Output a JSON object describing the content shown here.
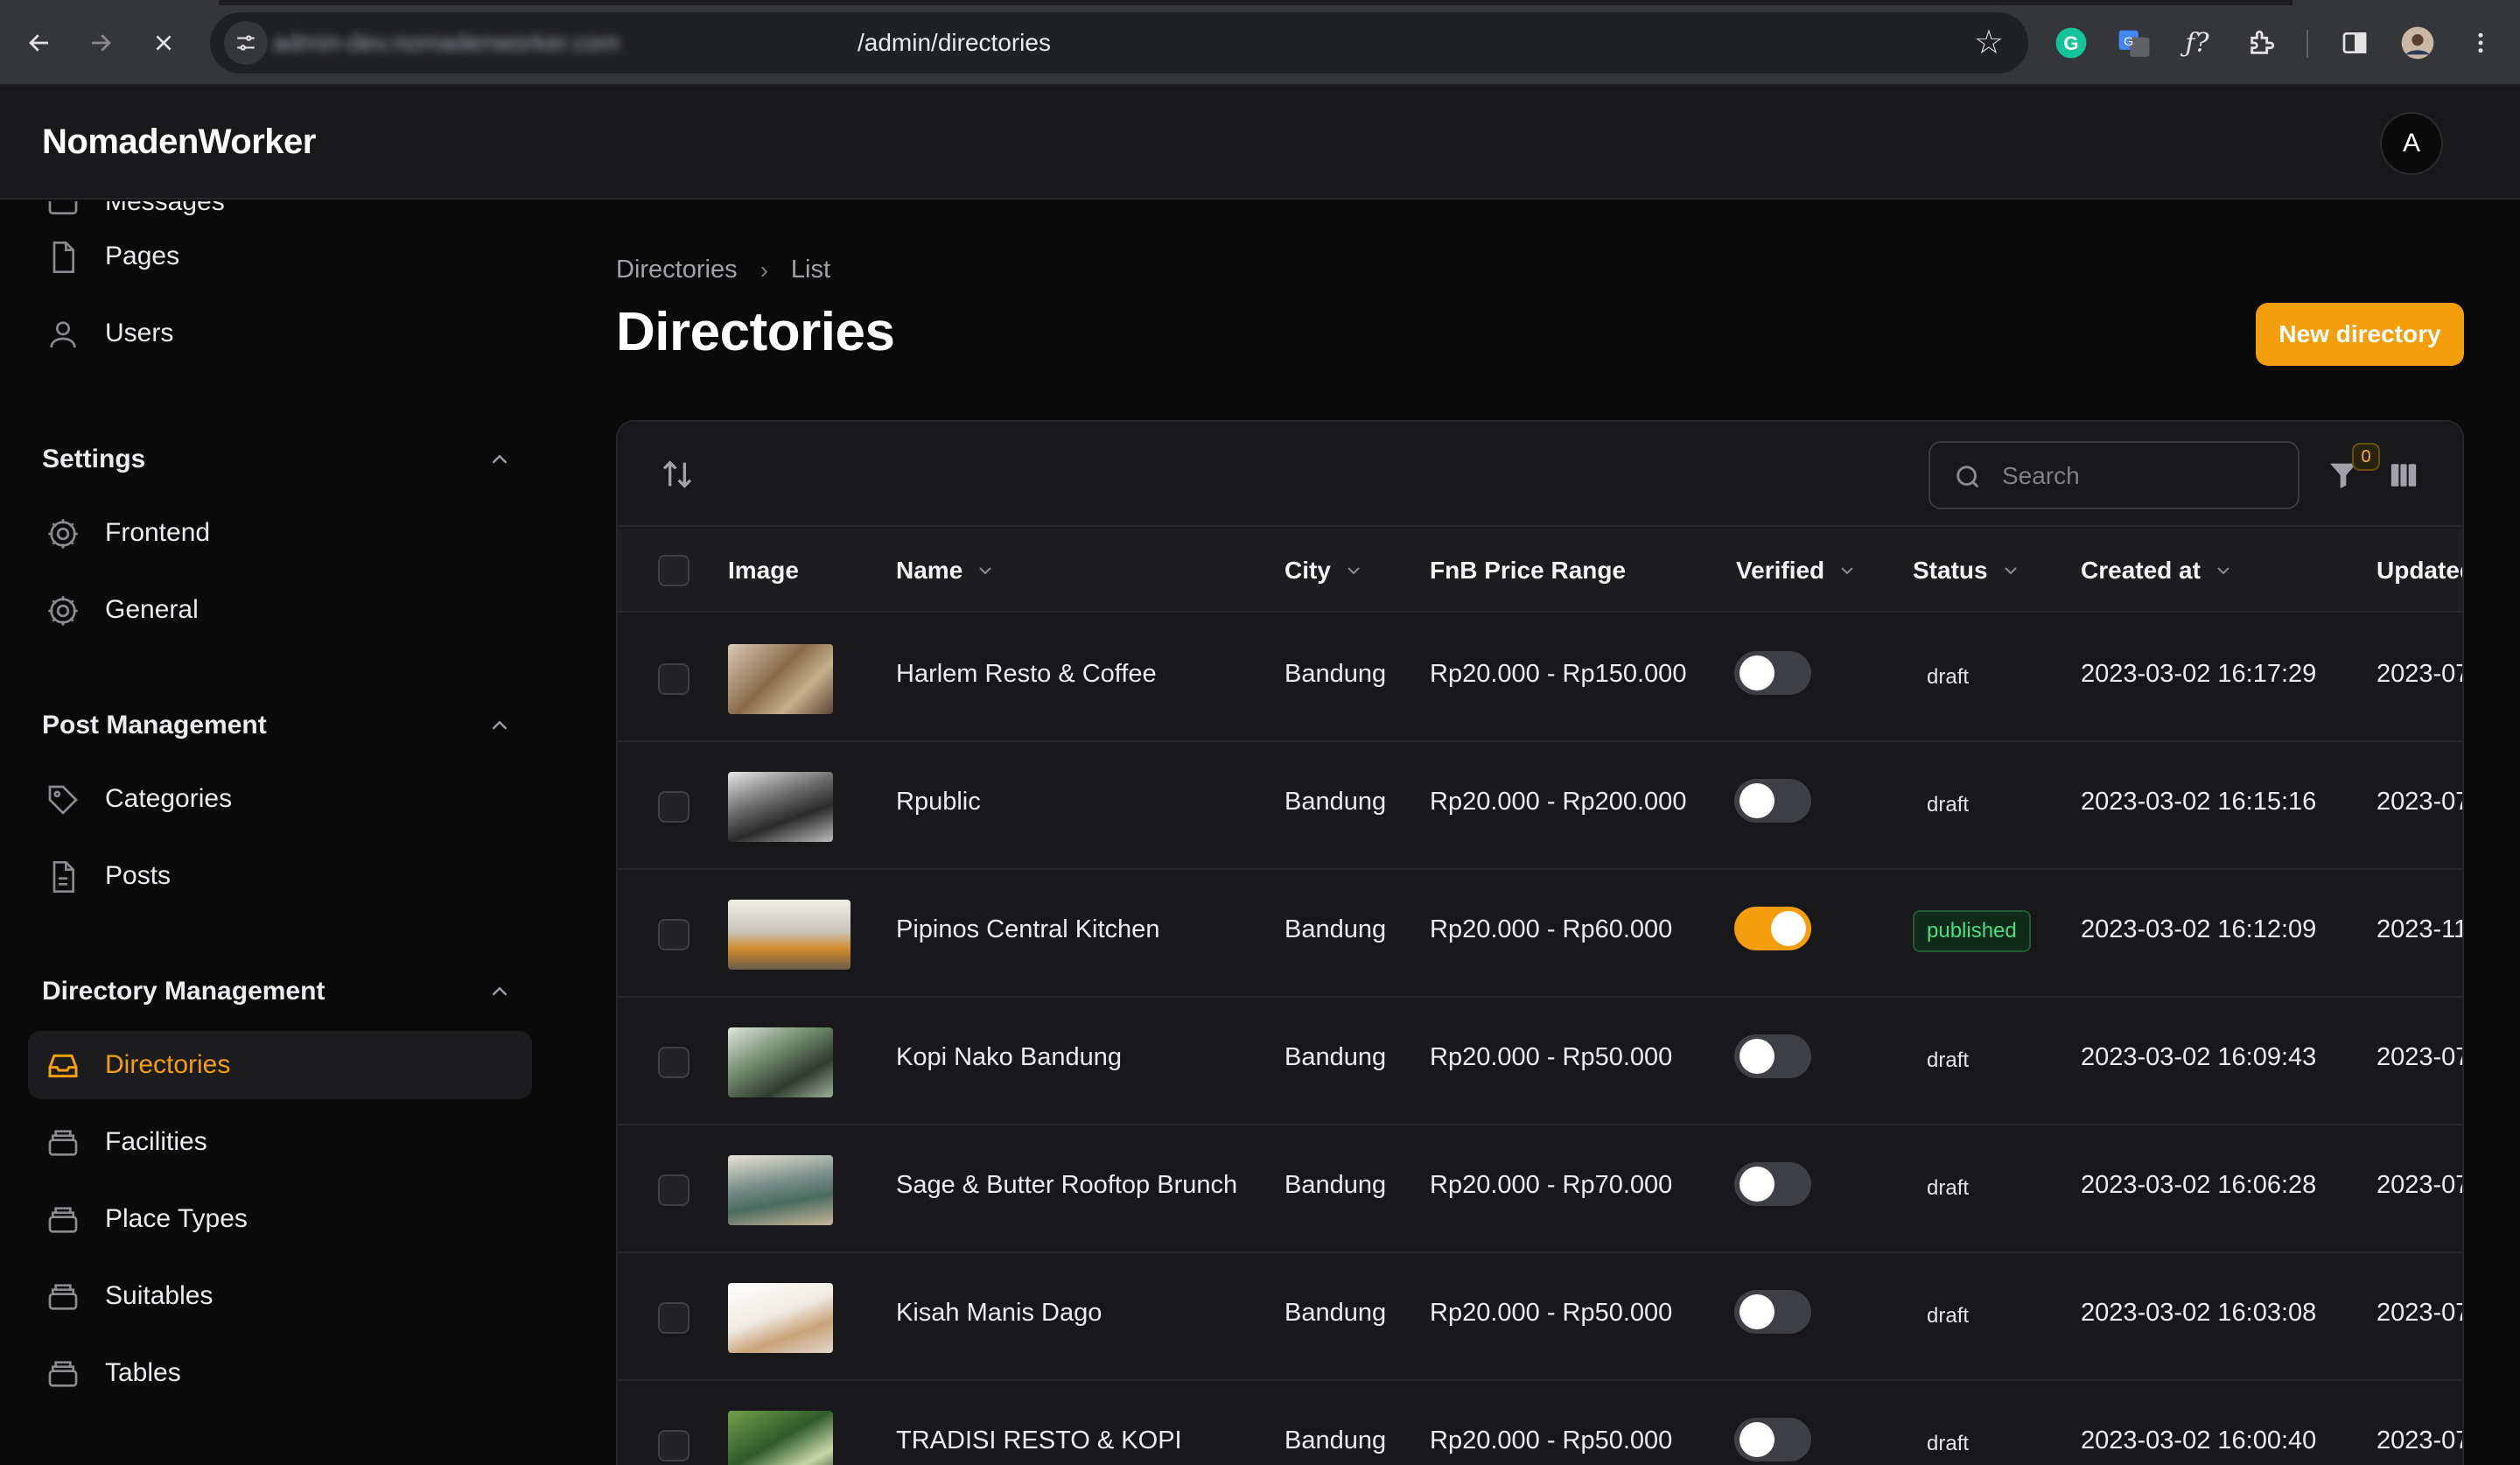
{
  "browser": {
    "url_host": "admin-dev.nomadenworker.com",
    "url_path": "/admin/directories"
  },
  "app": {
    "brand": "NomadenWorker",
    "avatar_initial": "A"
  },
  "sidebar": {
    "partial_item": "Messages",
    "items_top": [
      {
        "label": "Pages",
        "icon": "page-icon"
      },
      {
        "label": "Users",
        "icon": "user-icon"
      }
    ],
    "groups": [
      {
        "title": "Settings",
        "items": [
          {
            "label": "Frontend",
            "icon": "gear-icon"
          },
          {
            "label": "General",
            "icon": "gear-icon"
          }
        ]
      },
      {
        "title": "Post Management",
        "items": [
          {
            "label": "Categories",
            "icon": "tag-icon"
          },
          {
            "label": "Posts",
            "icon": "document-icon"
          }
        ]
      },
      {
        "title": "Directory Management",
        "items": [
          {
            "label": "Directories",
            "icon": "tray-icon",
            "active": true
          },
          {
            "label": "Facilities",
            "icon": "stack-icon"
          },
          {
            "label": "Place Types",
            "icon": "stack-icon"
          },
          {
            "label": "Suitables",
            "icon": "stack-icon"
          },
          {
            "label": "Tables",
            "icon": "stack-icon"
          }
        ]
      }
    ]
  },
  "main": {
    "breadcrumb": [
      "Directories",
      "List"
    ],
    "title": "Directories",
    "new_button": "New directory"
  },
  "table": {
    "search_placeholder": "Search",
    "filter_count": "0",
    "columns": [
      "Image",
      "Name",
      "City",
      "FnB Price Range",
      "Verified",
      "Status",
      "Created at",
      "Updated at"
    ],
    "rows": [
      {
        "name": "Harlem Resto & Coffee",
        "city": "Bandung",
        "price": "Rp20.000 - Rp150.000",
        "verified": false,
        "status": "draft",
        "created": "2023-03-02 16:17:29",
        "updated": "2023-07"
      },
      {
        "name": "Rpublic",
        "city": "Bandung",
        "price": "Rp20.000 - Rp200.000",
        "verified": false,
        "status": "draft",
        "created": "2023-03-02 16:15:16",
        "updated": "2023-07"
      },
      {
        "name": "Pipinos Central Kitchen",
        "city": "Bandung",
        "price": "Rp20.000 - Rp60.000",
        "verified": true,
        "status": "published",
        "created": "2023-03-02 16:12:09",
        "updated": "2023-11"
      },
      {
        "name": "Kopi Nako Bandung",
        "city": "Bandung",
        "price": "Rp20.000 - Rp50.000",
        "verified": false,
        "status": "draft",
        "created": "2023-03-02 16:09:43",
        "updated": "2023-07"
      },
      {
        "name": "Sage & Butter Rooftop Brunch",
        "city": "Bandung",
        "price": "Rp20.000 - Rp70.000",
        "verified": false,
        "status": "draft",
        "created": "2023-03-02 16:06:28",
        "updated": "2023-07"
      },
      {
        "name": "Kisah Manis Dago",
        "city": "Bandung",
        "price": "Rp20.000 - Rp50.000",
        "verified": false,
        "status": "draft",
        "created": "2023-03-02 16:03:08",
        "updated": "2023-07"
      },
      {
        "name": "TRADISI RESTO & KOPI",
        "city": "Bandung",
        "price": "Rp20.000 - Rp50.000",
        "verified": false,
        "status": "draft",
        "created": "2023-03-02 16:00:40",
        "updated": "2023-07"
      }
    ]
  },
  "colors": {
    "accent": "#f59e0b",
    "background": "#0a0a0b",
    "panel": "#18181b",
    "published": "#4ade80"
  }
}
